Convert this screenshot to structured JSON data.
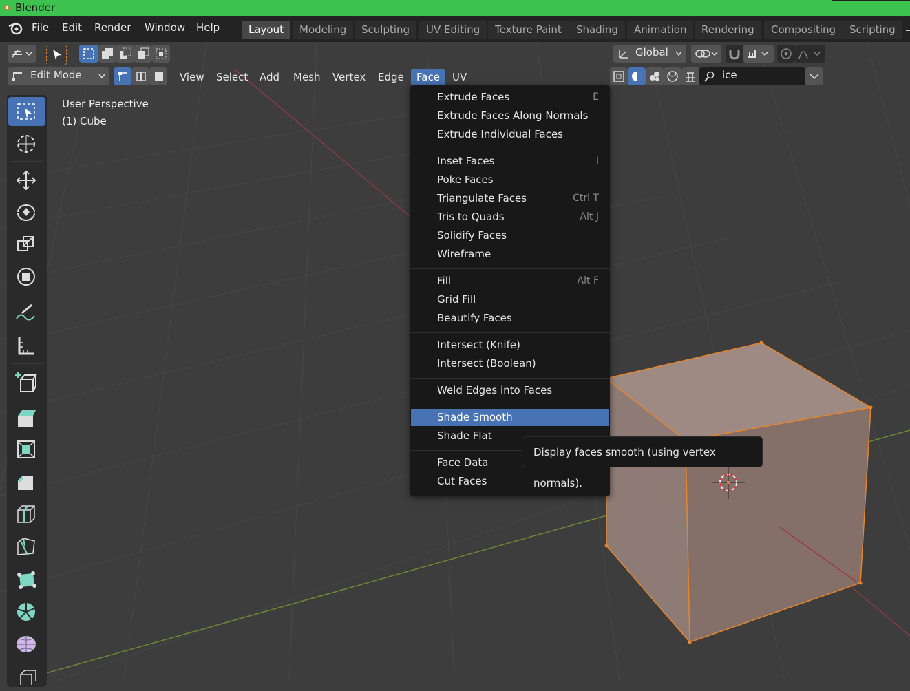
{
  "window": {
    "title": "Blender"
  },
  "menubar": {
    "menus": [
      "File",
      "Edit",
      "Render",
      "Window",
      "Help"
    ],
    "workspaces": [
      "Layout",
      "Modeling",
      "Sculpting",
      "UV Editing",
      "Texture Paint",
      "Shading",
      "Animation",
      "Rendering",
      "Compositing",
      "Scripting"
    ],
    "active_workspace": "Layout"
  },
  "header": {
    "transform_orientation": "Global",
    "mode": "Edit Mode",
    "menus": [
      "View",
      "Select",
      "Add",
      "Mesh",
      "Vertex",
      "Edge",
      "Face",
      "UV"
    ],
    "active_menu": "Face",
    "search_value": "ice"
  },
  "overlay": {
    "view_name": "User Perspective",
    "object_name": "(1) Cube"
  },
  "face_menu": {
    "items": [
      {
        "label": "Extrude Faces",
        "shortcut": "E"
      },
      {
        "label": "Extrude Faces Along Normals",
        "shortcut": ""
      },
      {
        "label": "Extrude Individual Faces",
        "shortcut": ""
      },
      {
        "label": "Inset Faces",
        "shortcut": "I"
      },
      {
        "label": "Poke Faces",
        "shortcut": ""
      },
      {
        "label": "Triangulate Faces",
        "shortcut": "Ctrl T"
      },
      {
        "label": "Tris to Quads",
        "shortcut": "Alt J"
      },
      {
        "label": "Solidify Faces",
        "shortcut": ""
      },
      {
        "label": "Wireframe",
        "shortcut": ""
      },
      {
        "label": "Fill",
        "shortcut": "Alt F"
      },
      {
        "label": "Grid Fill",
        "shortcut": ""
      },
      {
        "label": "Beautify Faces",
        "shortcut": ""
      },
      {
        "label": "Intersect (Knife)",
        "shortcut": ""
      },
      {
        "label": "Intersect (Boolean)",
        "shortcut": ""
      },
      {
        "label": "Weld Edges into Faces",
        "shortcut": ""
      },
      {
        "label": "Shade Smooth",
        "shortcut": ""
      },
      {
        "label": "Shade Flat",
        "shortcut": ""
      },
      {
        "label": "Face Data",
        "shortcut": ""
      },
      {
        "label": "Cut Faces",
        "shortcut": ""
      }
    ],
    "highlighted": "Shade Smooth"
  },
  "tooltip": {
    "text": "Display faces smooth (using vertex normals)."
  },
  "colors": {
    "accent": "#4772b3",
    "titlebar": "#3ec24f",
    "viewport_bg": "#3d3d3d",
    "menu_bg": "#181818",
    "selection_orange": "#e8852a"
  },
  "icons": {
    "toolbar": [
      "select-box-icon",
      "cursor-icon",
      "move-icon",
      "rotate-icon",
      "scale-icon",
      "transform-icon",
      "annotate-icon",
      "measure-icon",
      "add-cube-icon",
      "extrude-region-icon",
      "inset-faces-icon",
      "bevel-icon",
      "loop-cut-icon",
      "knife-icon",
      "poly-build-icon",
      "spin-icon",
      "smooth-icon",
      "shear-icon"
    ]
  }
}
